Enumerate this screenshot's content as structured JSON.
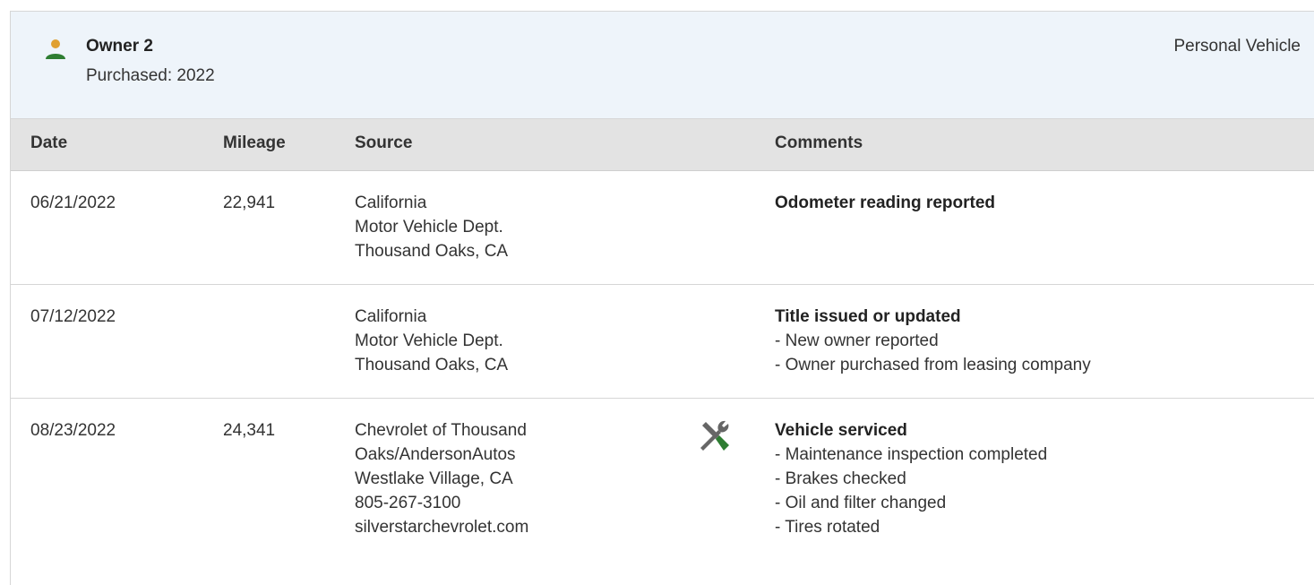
{
  "owner": {
    "name": "Owner 2",
    "purchased": "Purchased: 2022",
    "vehicle_type": "Personal Vehicle",
    "icon": "person-icon",
    "icon_color": "#2e7d32"
  },
  "table": {
    "headers": {
      "date": "Date",
      "mileage": "Mileage",
      "source": "Source",
      "comments": "Comments"
    },
    "rows": [
      {
        "date": "06/21/2022",
        "mileage": "22,941",
        "source": [
          "California",
          "Motor Vehicle Dept.",
          "Thousand Oaks, CA"
        ],
        "icon": "",
        "comment_title": "Odometer reading reported",
        "comment_items": []
      },
      {
        "date": "07/12/2022",
        "mileage": "",
        "source": [
          "California",
          "Motor Vehicle Dept.",
          "Thousand Oaks, CA"
        ],
        "icon": "",
        "comment_title": "Title issued or updated",
        "comment_items": [
          "- New owner reported",
          "- Owner purchased from leasing company"
        ]
      },
      {
        "date": "08/23/2022",
        "mileage": "24,341",
        "source": [
          "Chevrolet of Thousand",
          "Oaks/AndersonAutos",
          "Westlake Village, CA",
          "805-267-3100",
          "silverstarchevrolet.com"
        ],
        "icon": "wrench-screwdriver-icon",
        "comment_title": "Vehicle serviced",
        "comment_items": [
          "- Maintenance inspection completed",
          "- Brakes checked",
          "- Oil and filter changed",
          "- Tires rotated"
        ]
      }
    ]
  },
  "colors": {
    "header_bg": "#eef4fa",
    "table_header_bg": "#e3e3e3",
    "icon_green": "#2e7d32",
    "icon_gray": "#666666"
  }
}
